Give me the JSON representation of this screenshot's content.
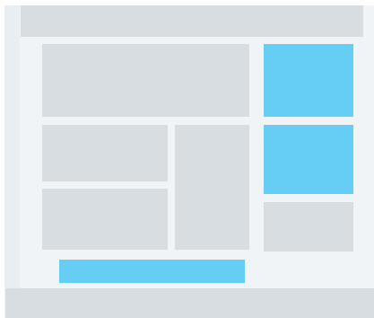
{
  "colors": {
    "background": "#f0f4f7",
    "side_panel": "#e9eef2",
    "placeholder_grey": "#d8dde1",
    "accent_blue": "#66cdf4"
  },
  "blocks": {
    "header_bar": "",
    "hero_block": "",
    "middle_left_block": "",
    "lower_left_block": "",
    "center_tall_block": "",
    "right_accent_top": "",
    "right_accent_middle": "",
    "right_grey_block": "",
    "action_bar": "",
    "footer_bar": ""
  }
}
